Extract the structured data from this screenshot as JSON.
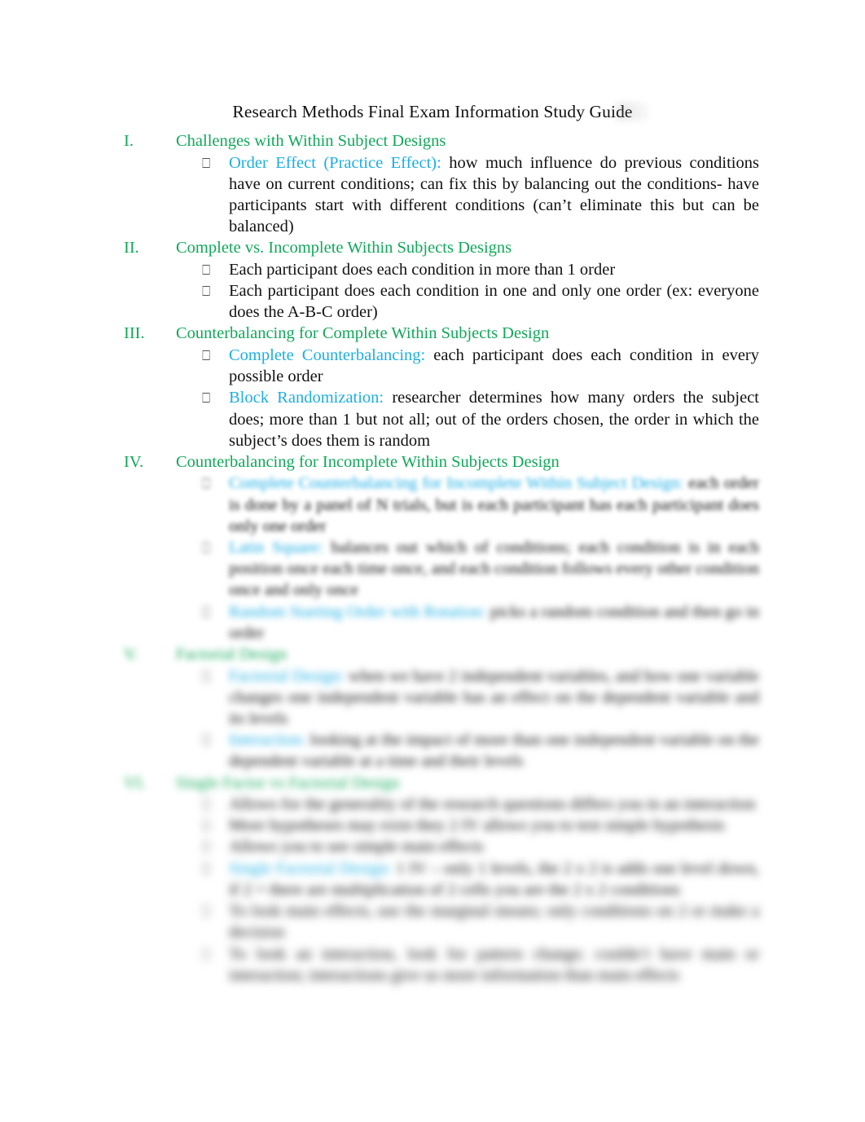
{
  "document": {
    "title": "Research Methods Final Exam Information Study Guide",
    "colors": {
      "heading_green": "#0FA958",
      "term_cyan": "#1BAEE5",
      "body_black": "#111111",
      "page_background": "#FFFFFF"
    },
    "bullet_glyph": "⎕"
  },
  "outline": [
    {
      "numeral": "I.",
      "heading": "Challenges with Within Subject Designs",
      "blur": 0,
      "items": [
        {
          "term": "Order Effect (Practice Effect):",
          "text": " how much influence do previous conditions have on current conditions; can fix this by balancing out the conditions- have participants start with different conditions (can’t eliminate this but can be balanced)",
          "blur": 0
        }
      ]
    },
    {
      "numeral": "II.",
      "heading": "Complete vs. Incomplete Within Subjects Designs",
      "blur": 0,
      "items": [
        {
          "term": "",
          "text": "Each participant does each condition in more than 1 order",
          "blur": 0
        },
        {
          "term": "",
          "text": "Each participant does each condition in one and only one order (ex: everyone does the A-B-C order)",
          "blur": 0
        }
      ]
    },
    {
      "numeral": "III.",
      "heading": "Counterbalancing for Complete Within Subjects Design",
      "blur": 0,
      "items": [
        {
          "term": "Complete Counterbalancing:",
          "text": " each participant does each condition in every possible order",
          "blur": 0
        },
        {
          "term": "Block Randomization:",
          "text": " researcher determines how many orders the subject does; more than 1 but not all; out of the orders chosen, the order in which the subject’s does them is random",
          "blur": 0
        }
      ]
    },
    {
      "numeral": "IV.",
      "heading": "Counterbalancing for Incomplete Within Subjects Design",
      "blur": 0,
      "items": [
        {
          "term": "Complete Counterbalancing for Incomplete Within Subject Design:",
          "text": " each order is done by a panel of N trials, but is each participant has each participant does only one order",
          "blur": 1
        },
        {
          "term": "Latin Square:",
          "text": " balances out which of conditions; each condition is in each position once each time once, and each condition follows every other condition once and only once",
          "blur": 2
        },
        {
          "term": "Random Starting Order with Rotation:",
          "text": " picks a random condition and then go in order",
          "blur": 3
        }
      ]
    },
    {
      "numeral": "V.",
      "heading": "Factorial Design",
      "blur": 3,
      "items": [
        {
          "term": "Factorial Design:",
          "text": " when we have 2 independent variables, and how one variable changes one independent variable has an effect on the dependent variable and its levels",
          "blur": 4
        },
        {
          "term": "Interaction:",
          "text": " looking at the impact of more than one independent variable on the dependent variable at a time and their levels",
          "blur": 4
        }
      ]
    },
    {
      "numeral": "VI.",
      "heading": "Single Factor vs Factorial Design",
      "blur": 4,
      "items": [
        {
          "term": "",
          "text": "Allows for the generality of the research questions differs you in an interaction",
          "blur": 5
        },
        {
          "term": "",
          "text": "More hypotheses may exist they  2 IV allows you to test simple hypothesis",
          "blur": 5
        },
        {
          "term": "",
          "text": "Allows you to see simple main effects",
          "blur": 5
        },
        {
          "term": "Single Factorial Design:",
          "text": " 1 IV – only 1 levels, the 2 x 2 is adds one level down, if 2 = there are  multiplication of 2 cells you are the 2 x 2 conditions",
          "blur": 5
        },
        {
          "term": "",
          "text": "To look main effects, use the marginal means; only conditions on 2 or make a decision",
          "blur": 6
        },
        {
          "term": "",
          "text": "To look an interaction, look for pattern change; couldn’t have main or interaction; interactions give us more information than main effects",
          "blur": 6
        }
      ]
    }
  ]
}
